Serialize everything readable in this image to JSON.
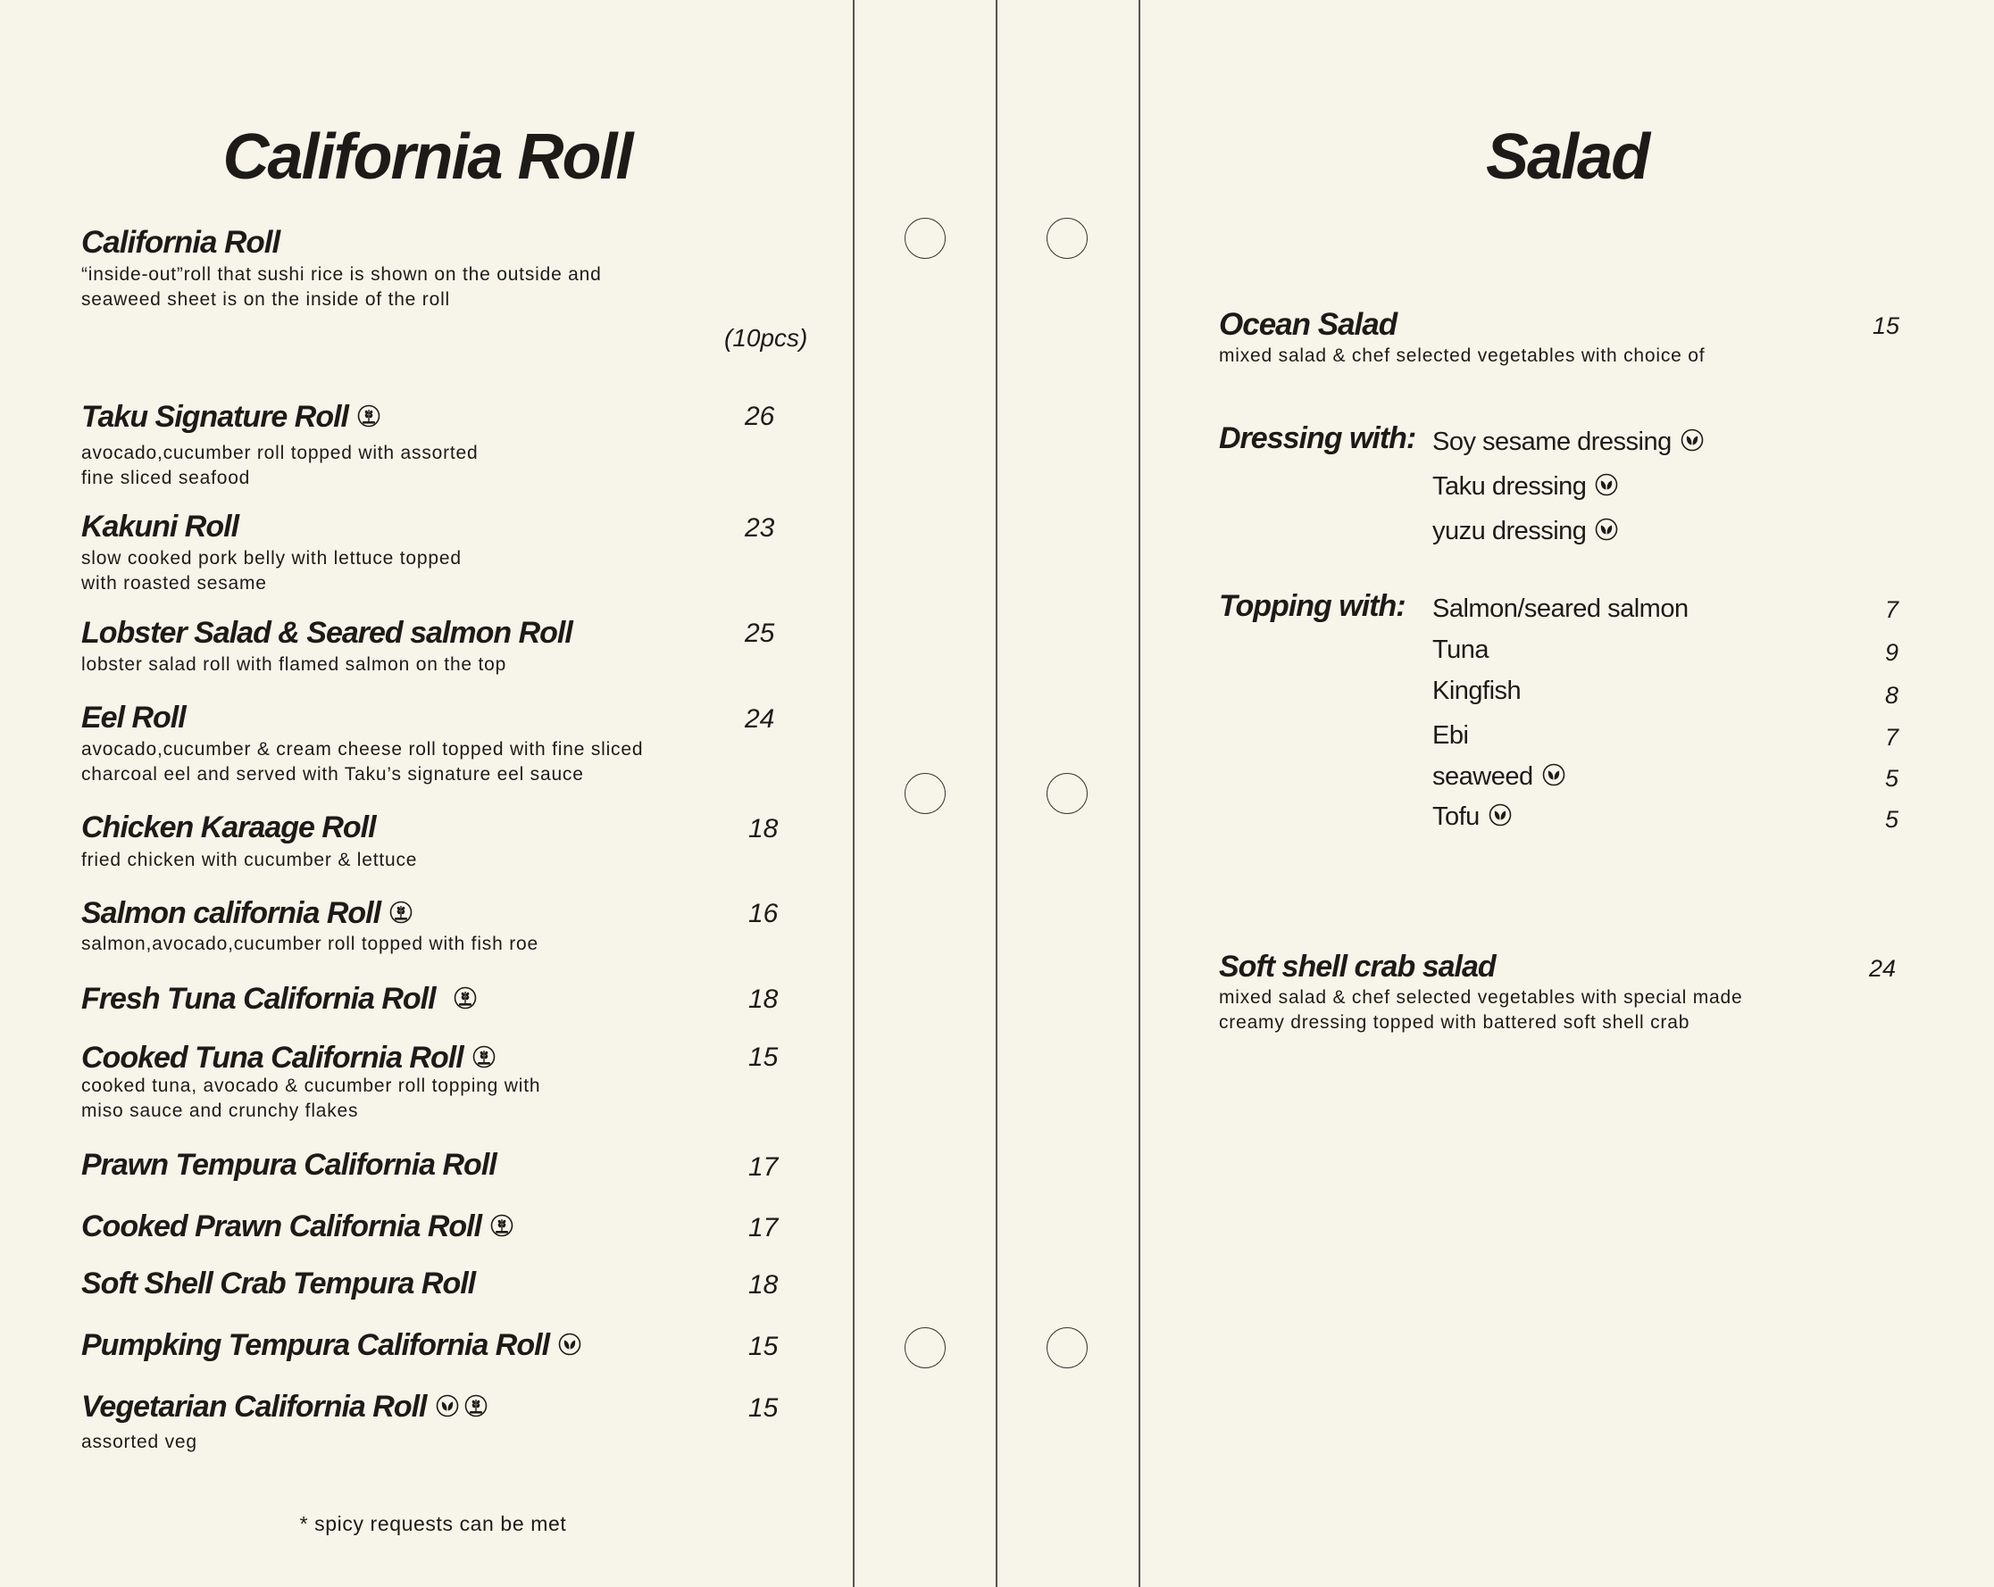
{
  "left": {
    "title": "California Roll",
    "intro_name": "California Roll",
    "intro_desc": "“inside-out”roll that sushi rice is shown on the outside and\n seaweed sheet is on the inside of the roll",
    "count": "(10pcs)",
    "items": [
      {
        "name": "Taku Signature Roll",
        "price": "26",
        "desc": "avocado,cucumber roll topped with assorted\nfine sliced seafood",
        "icons": [
          "gluten-free-icon"
        ]
      },
      {
        "name": "Kakuni Roll",
        "price": "23",
        "desc": "slow cooked pork belly with lettuce topped\nwith roasted sesame",
        "icons": []
      },
      {
        "name": "Lobster Salad & Seared salmon Roll",
        "price": "25",
        "desc": "lobster salad roll with flamed salmon on the top",
        "icons": []
      },
      {
        "name": "Eel Roll",
        "price": "24",
        "desc": "avocado,cucumber & cream cheese roll topped with fine sliced\ncharcoal eel and served with Taku’s signature eel sauce",
        "icons": []
      },
      {
        "name": "Chicken Karaage Roll",
        "price": "18",
        "desc": "fried chicken with cucumber & lettuce",
        "icons": []
      },
      {
        "name": "Salmon california Roll",
        "price": "16",
        "desc": "salmon,avocado,cucumber roll topped with fish roe",
        "icons": [
          "gluten-free-icon"
        ]
      },
      {
        "name": "Fresh Tuna California Roll",
        "price": "18",
        "desc": "",
        "icons": [
          "gluten-free-icon"
        ]
      },
      {
        "name": "Cooked Tuna California Roll",
        "price": "15",
        "desc": "cooked tuna, avocado & cucumber roll topping with\nmiso sauce and crunchy flakes",
        "icons": [
          "gluten-free-icon"
        ]
      },
      {
        "name": "Prawn Tempura California Roll",
        "price": "17",
        "desc": "",
        "icons": []
      },
      {
        "name": "Cooked Prawn California Roll",
        "price": "17",
        "desc": "",
        "icons": [
          "gluten-free-icon"
        ]
      },
      {
        "name": "Soft Shell Crab Tempura Roll",
        "price": "18",
        "desc": "",
        "icons": []
      },
      {
        "name": "Pumpking Tempura California Roll",
        "price": "15",
        "desc": "",
        "icons": [
          "vegan-leaf-icon"
        ]
      },
      {
        "name": "Vegetarian California Roll",
        "price": "15",
        "desc": "assorted veg",
        "icons": [
          "vegan-leaf-icon",
          "gluten-free-icon"
        ]
      }
    ],
    "footnote": "* spicy requests can be met"
  },
  "right": {
    "title": "Salad",
    "ocean": {
      "name": "Ocean Salad",
      "price": "15",
      "desc": "mixed salad & chef selected vegetables with choice of"
    },
    "dressing_label": "Dressing with:",
    "dressings": [
      {
        "label": "Soy sesame dressing",
        "icons": [
          "vegan-leaf-icon"
        ]
      },
      {
        "label": "Taku dressing",
        "icons": [
          "vegan-leaf-icon"
        ]
      },
      {
        "label": "yuzu dressing",
        "icons": [
          "vegan-leaf-icon"
        ]
      }
    ],
    "topping_label": "Topping with:",
    "toppings": [
      {
        "label": "Salmon/seared salmon",
        "price": "7",
        "icons": []
      },
      {
        "label": "Tuna",
        "price": "9",
        "icons": []
      },
      {
        "label": "Kingfish",
        "price": "8",
        "icons": []
      },
      {
        "label": "Ebi",
        "price": "7",
        "icons": []
      },
      {
        "label": "seaweed",
        "price": "5",
        "icons": [
          "vegan-leaf-icon"
        ]
      },
      {
        "label": "Tofu",
        "price": "5",
        "icons": [
          "vegan-leaf-icon"
        ]
      }
    ],
    "crab": {
      "name": "Soft shell crab salad",
      "price": "24",
      "desc": "mixed salad & chef selected vegetables with special made\ncreamy dressing topped with battered soft shell crab"
    }
  }
}
